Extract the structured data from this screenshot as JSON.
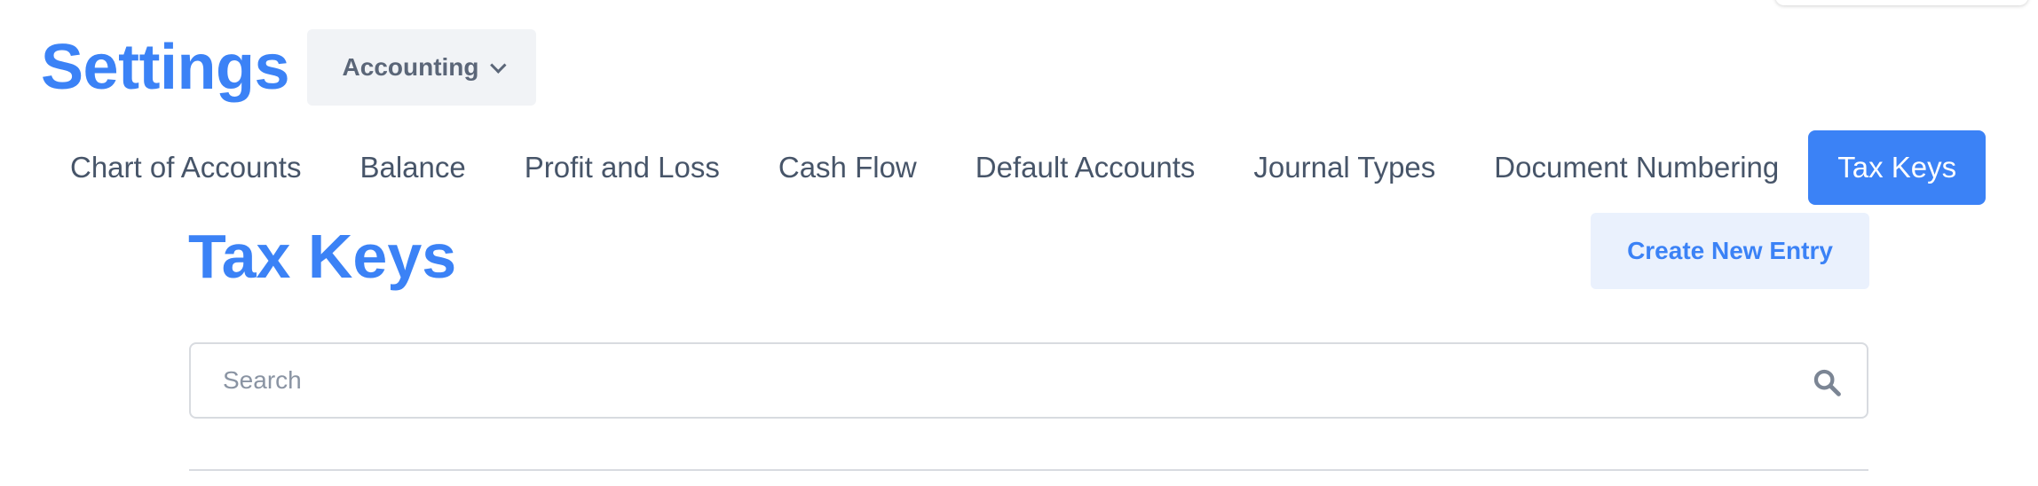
{
  "header": {
    "title": "Settings",
    "section_selector": {
      "selected": "Accounting"
    }
  },
  "tabs": [
    {
      "label": "Chart of Accounts",
      "active": false
    },
    {
      "label": "Balance",
      "active": false
    },
    {
      "label": "Profit and Loss",
      "active": false
    },
    {
      "label": "Cash Flow",
      "active": false
    },
    {
      "label": "Default Accounts",
      "active": false
    },
    {
      "label": "Journal Types",
      "active": false
    },
    {
      "label": "Document Numbering",
      "active": false
    },
    {
      "label": "Tax Keys",
      "active": true
    }
  ],
  "main": {
    "title": "Tax Keys",
    "create_button_label": "Create New Entry",
    "search": {
      "value": "",
      "placeholder": "Search"
    }
  },
  "colors": {
    "accent": "#3b82f6",
    "text": "#475569",
    "muted_bg": "#f1f3f6",
    "accent_light_bg": "#eaf1fd"
  },
  "icons": {
    "selector_chevron": "chevron-down-icon",
    "search": "search-icon"
  }
}
